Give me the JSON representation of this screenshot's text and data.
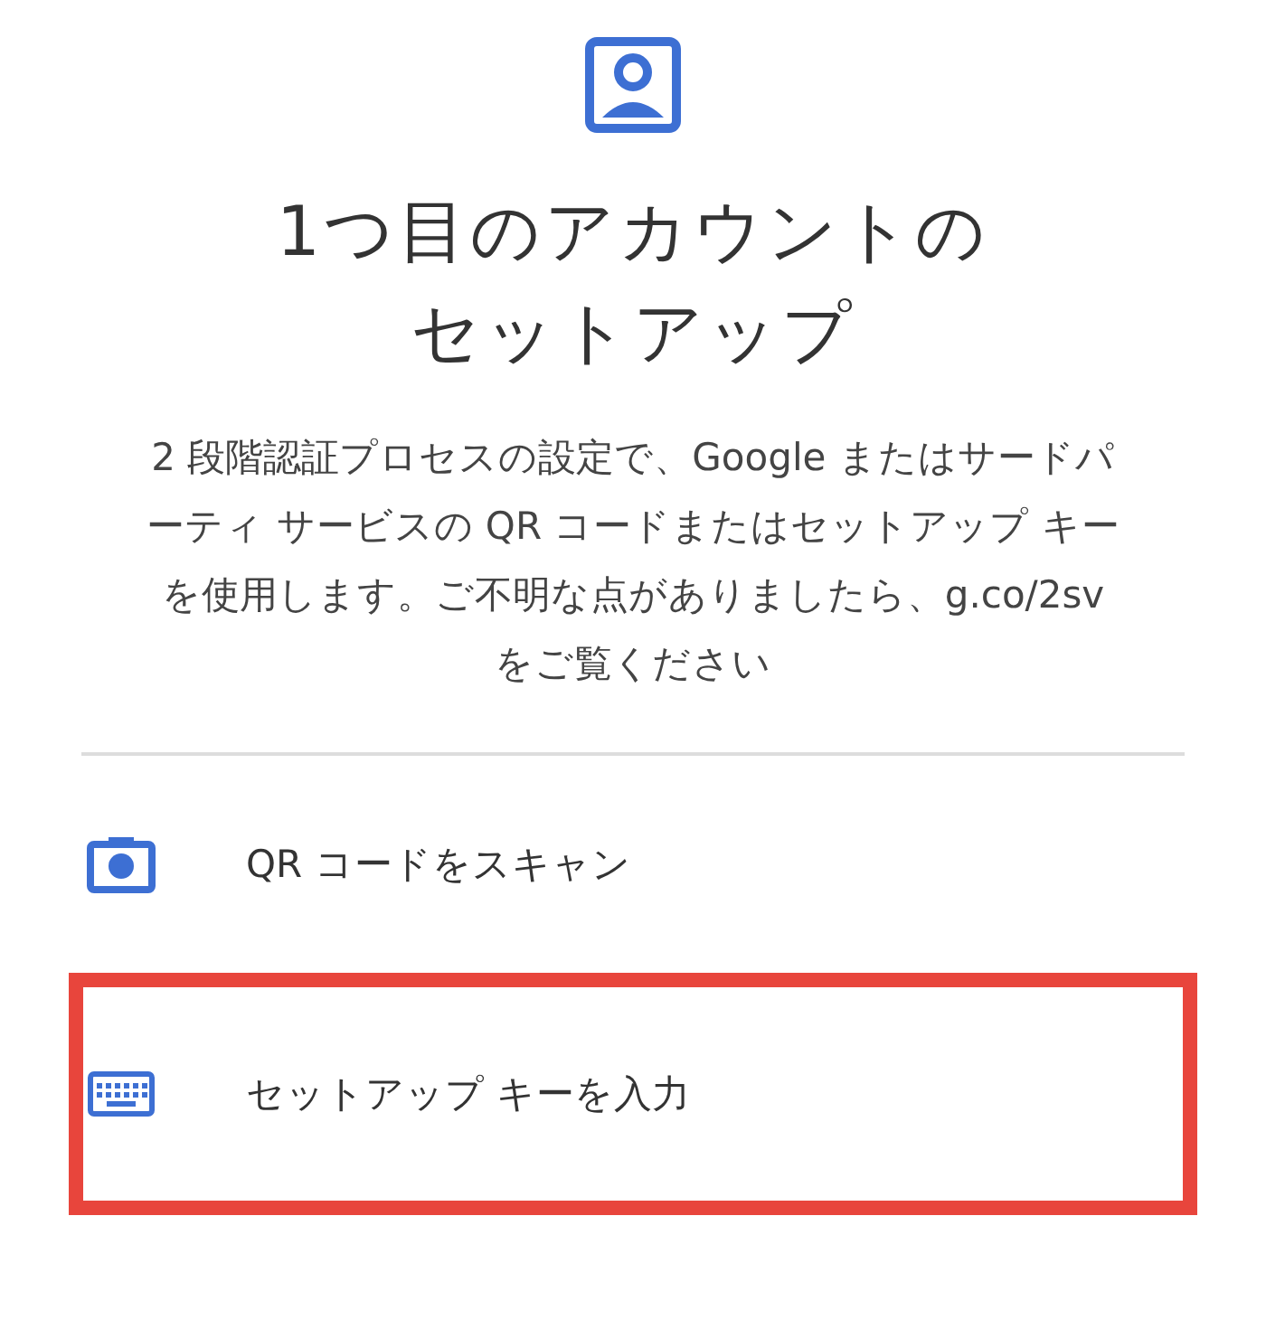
{
  "title_lines": [
    "1つ目のアカウントの",
    "セットアップ"
  ],
  "description_lines": [
    "2 段階認証プロセスの設定で、Google またはサードパ",
    "ーティ サービスの QR コードまたはセットアップ キー",
    "を使用します。ご不明な点がありましたら、g.co/2sv",
    "をご覧ください"
  ],
  "options": [
    {
      "kind": "camera",
      "label": "QR コードをスキャン",
      "highlighted": false
    },
    {
      "kind": "keyboard",
      "label": "セットアップ キーを入力",
      "highlighted": true
    }
  ]
}
